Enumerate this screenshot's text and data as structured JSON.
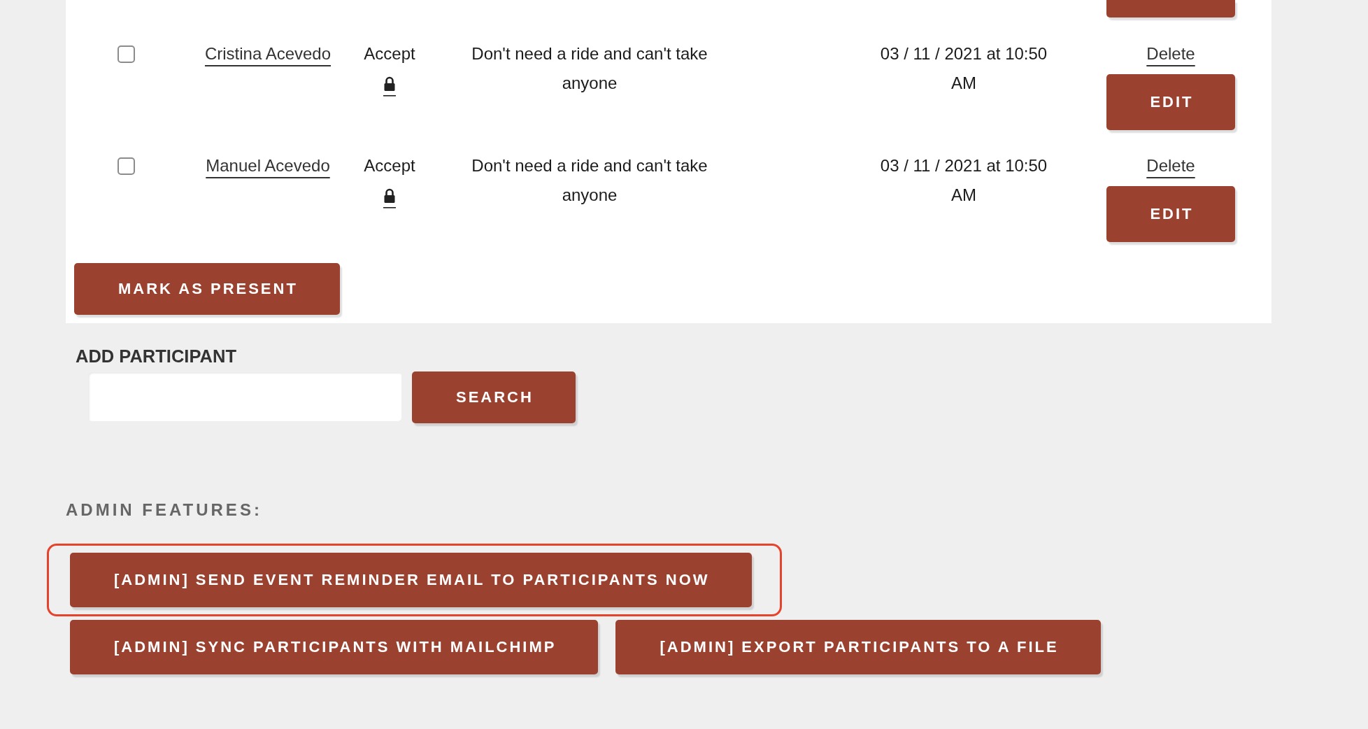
{
  "participants": {
    "partial_row_above": true,
    "rows": [
      {
        "checked": false,
        "name": "Cristina Acevedo",
        "response": "Accept",
        "locked": true,
        "note": "Don't need a ride and can't take anyone",
        "date": "03 / 11 / 2021 at 10:50 AM",
        "delete": "Delete",
        "edit": "EDIT"
      },
      {
        "checked": false,
        "name": "Manuel Acevedo",
        "response": "Accept",
        "locked": true,
        "note": "Don't need a ride and can't take anyone",
        "date": "03 / 11 / 2021 at 10:50 AM",
        "delete": "Delete",
        "edit": "EDIT"
      }
    ],
    "mark_button": "MARK AS PRESENT"
  },
  "add_participant": {
    "title": "ADD PARTICIPANT",
    "search_button": "SEARCH"
  },
  "admin": {
    "title": "ADMIN FEATURES:",
    "button_rows": [
      [
        {
          "label": "[ADMIN] SEND EVENT REMINDER EMAIL TO PARTICIPANTS NOW",
          "highlighted": true
        }
      ],
      [
        {
          "label": "[ADMIN] SYNC PARTICIPANTS WITH MAILCHIMP",
          "highlighted": false
        },
        {
          "label": "[ADMIN] EXPORT PARTICIPANTS TO A FILE",
          "highlighted": false
        }
      ]
    ]
  }
}
